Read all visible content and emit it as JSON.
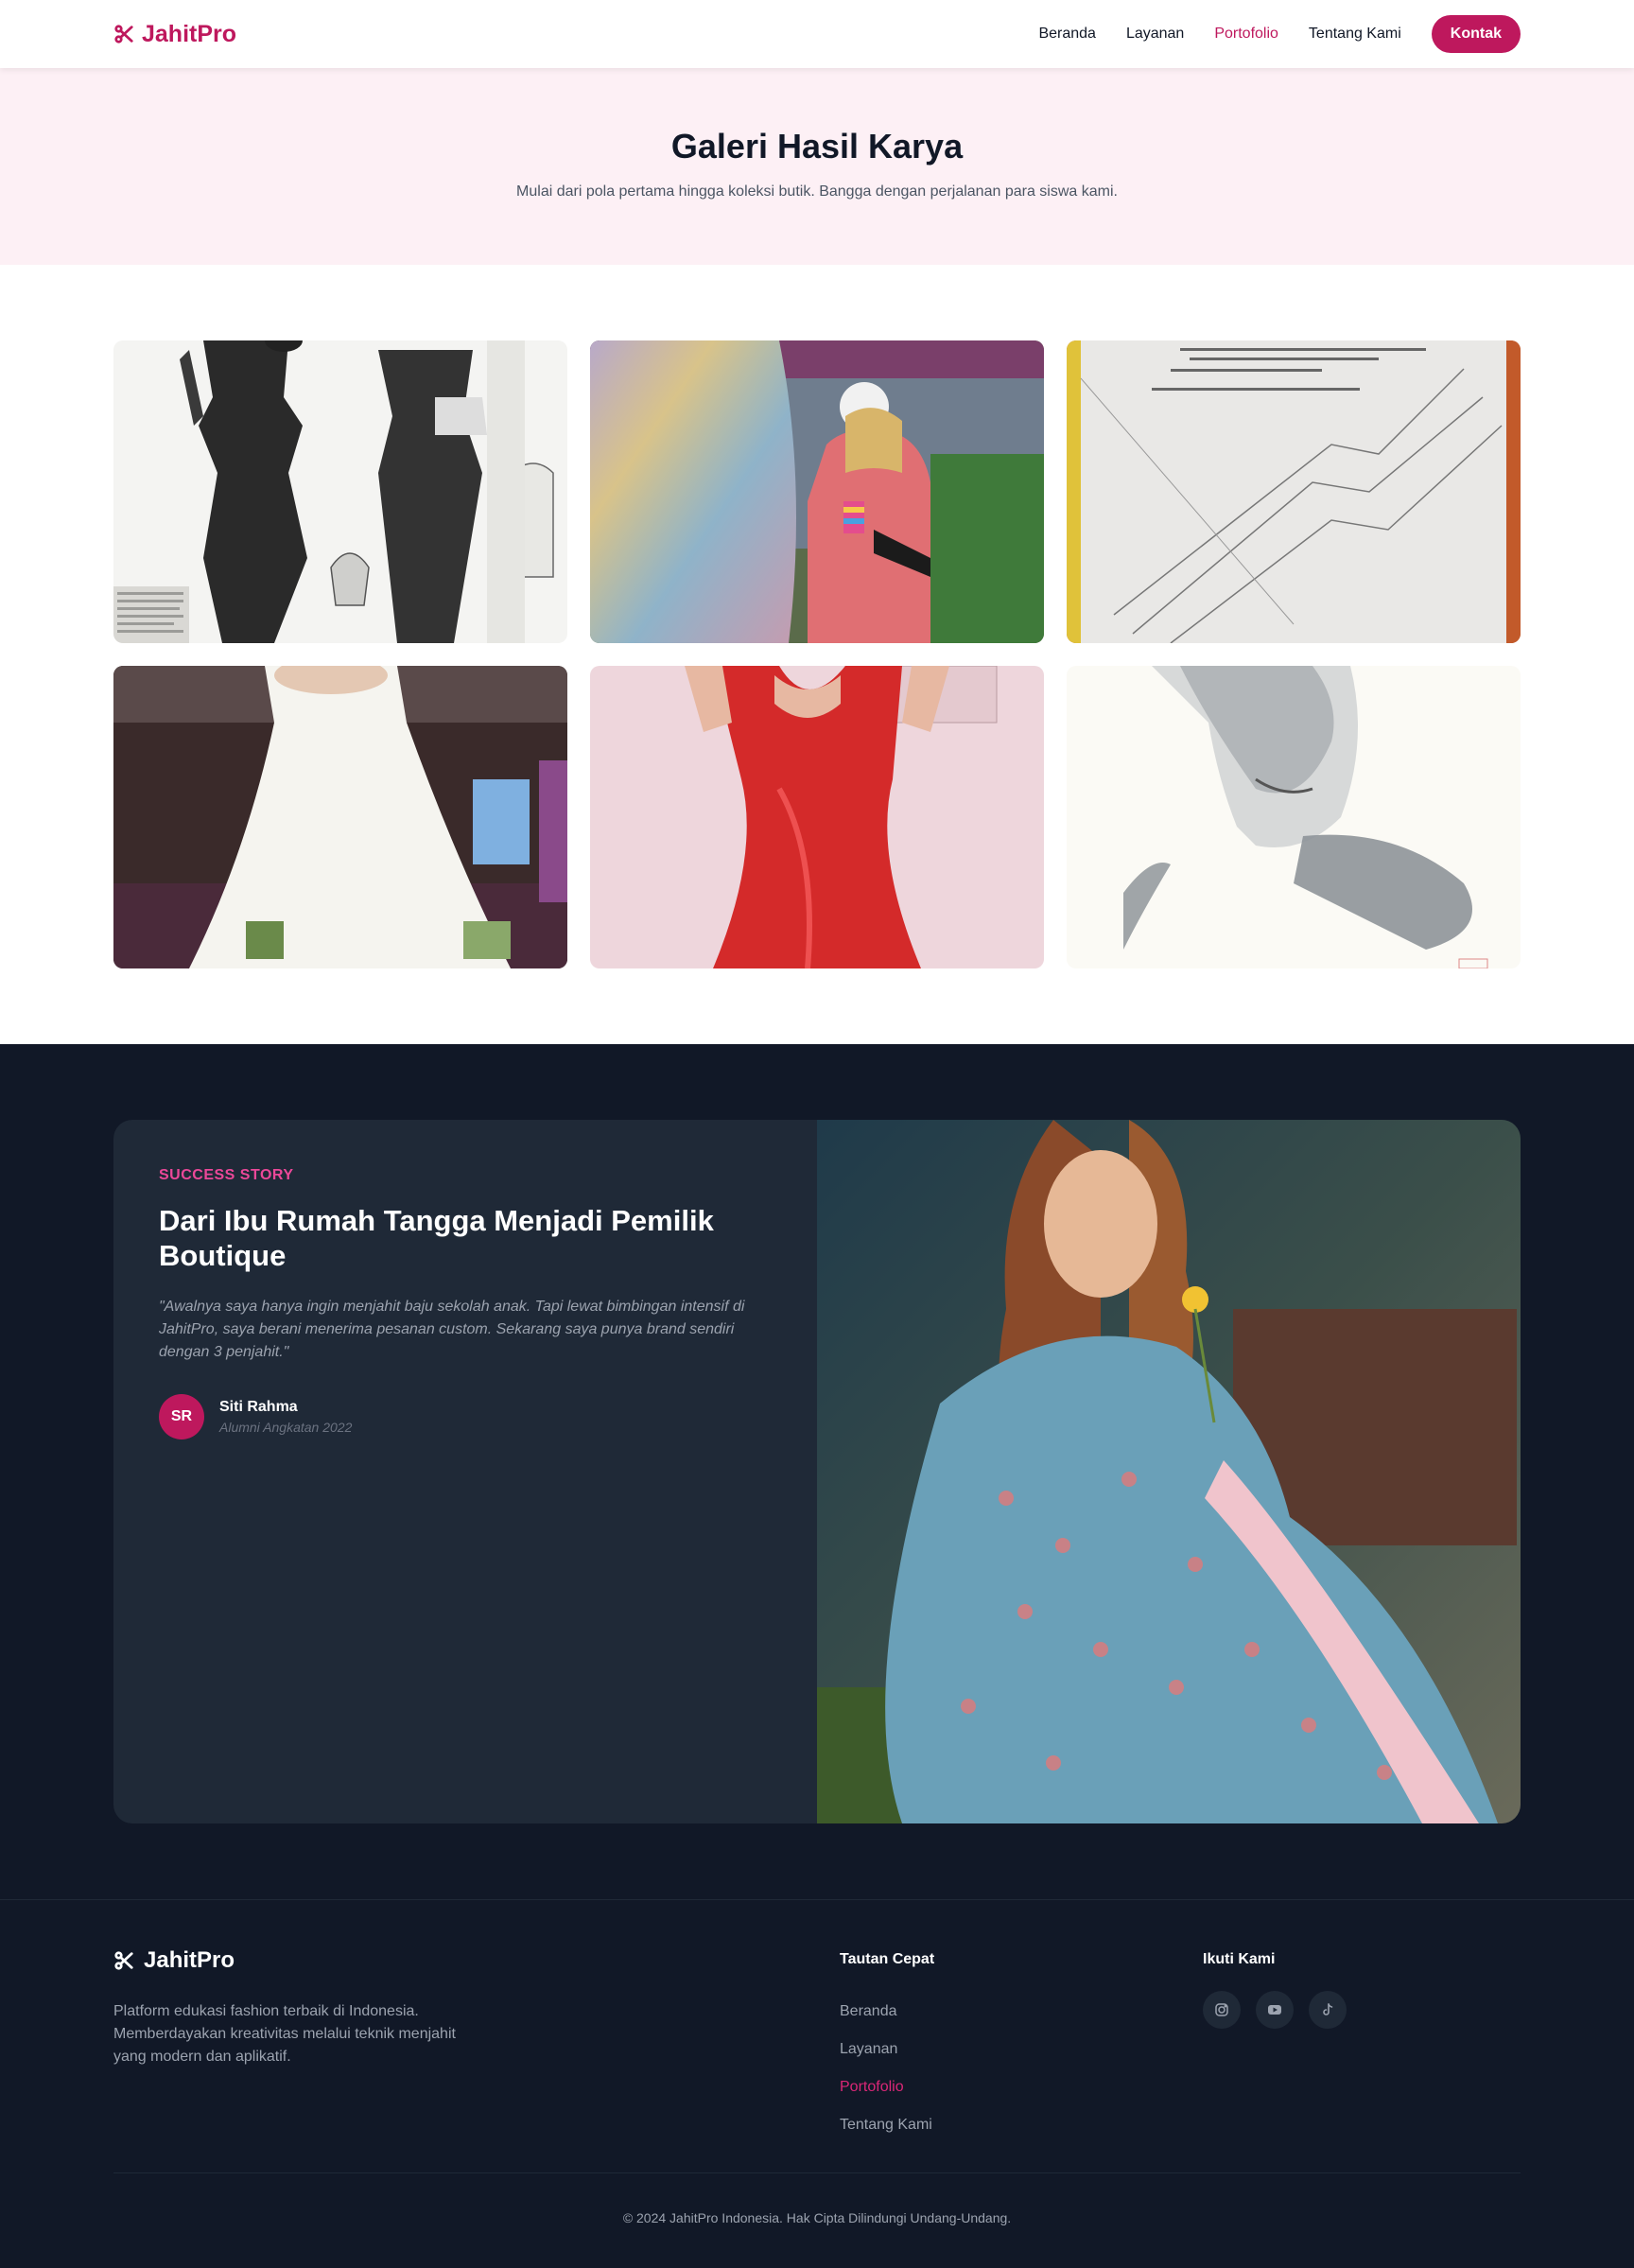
{
  "header": {
    "logo_text": "JahitPro",
    "nav": [
      {
        "label": "Beranda",
        "active": false
      },
      {
        "label": "Layanan",
        "active": false
      },
      {
        "label": "Portofolio",
        "active": true
      },
      {
        "label": "Tentang Kami",
        "active": false
      }
    ],
    "contact_label": "Kontak"
  },
  "hero": {
    "title": "Galeri Hasil Karya",
    "subtitle": "Mulai dari pola pertama hingga koleksi butik. Bangga dengan perjalanan para siswa kami."
  },
  "gallery": {
    "items": [
      {
        "name": "vintage-fashion-sketch"
      },
      {
        "name": "sequin-fabric-parade"
      },
      {
        "name": "sewing-pattern-paper"
      },
      {
        "name": "white-wedding-gown"
      },
      {
        "name": "red-satin-dress"
      },
      {
        "name": "watercolor-portrait"
      }
    ]
  },
  "story": {
    "tag": "SUCCESS STORY",
    "title": "Dari Ibu Rumah Tangga Menjadi Pemilik Boutique",
    "quote": "\"Awalnya saya hanya ingin menjahit baju sekolah anak. Tapi lewat bimbingan intensif di JahitPro, saya berani menerima pesanan custom. Sekarang saya punya brand sendiri dengan 3 penjahit.\"",
    "author_initials": "SR",
    "author_name": "Siti Rahma",
    "author_subtitle": "Alumni Angkatan 2022"
  },
  "footer": {
    "logo_text": "JahitPro",
    "description": "Platform edukasi fashion terbaik di Indonesia. Memberdayakan kreativitas melalui teknik menjahit yang modern dan aplikatif.",
    "quick_links_title": "Tautan Cepat",
    "quick_links": [
      {
        "label": "Beranda",
        "active": false
      },
      {
        "label": "Layanan",
        "active": false
      },
      {
        "label": "Portofolio",
        "active": true
      },
      {
        "label": "Tentang Kami",
        "active": false
      }
    ],
    "follow_title": "Ikuti Kami",
    "socials": [
      "instagram-icon",
      "youtube-icon",
      "tiktok-icon"
    ],
    "copyright": "© 2024 JahitPro Indonesia. Hak Cipta Dilindungi Undang-Undang."
  },
  "colors": {
    "brand": "#be185d",
    "hero_bg": "#fdf0f5",
    "dark_bg": "#111827",
    "card_bg": "#1f2937"
  }
}
